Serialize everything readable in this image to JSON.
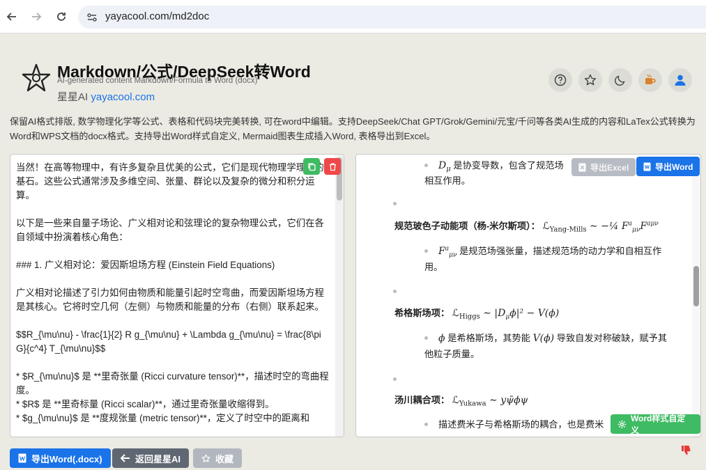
{
  "browser": {
    "url": "yayacool.com/md2doc",
    "back_icon": "arrow-left-icon",
    "forward_icon": "arrow-right-icon",
    "reload_icon": "reload-icon"
  },
  "header": {
    "title": "Markdown/公式/DeepSeek转Word",
    "subtitle": "AI-generated content Markdown/Formula to Word (docx)",
    "brand_name": "星星AI",
    "brand_link": "yayacool.com",
    "icons": [
      "help-icon",
      "star-icon",
      "moon-icon",
      "coffee-icon",
      "user-icon"
    ]
  },
  "description": "保留AI格式排版, 数学物理化学等公式、表格和代码块完美转换, 可在word中编辑。支持DeepSeek/Chat GPT/Grok/Gemini/元宝/千问等各类AI生成的内容和LaTex公式转换为Word和WPS文档的docx格式。支持导出Word样式自定义, Mermaid图表生成插入Word, 表格导出到Excel。",
  "editor": {
    "text": "当然！在高等物理中，有许多复杂且优美的公式，它们是现代物理学理论的基石。这些公式通常涉及多维空间、张量、群论以及复杂的微分和积分运算。\n\n以下是一些来自量子场论、广义相对论和弦理论的复杂物理公式，它们在各自领域中扮演着核心角色：\n\n### 1. 广义相对论：爱因斯坦场方程 (Einstein Field Equations)\n\n广义相对论描述了引力如何由物质和能量引起时空弯曲，而爱因斯坦场方程是其核心。它将时空几何（左侧）与物质和能量的分布（右侧）联系起来。\n\n$$R_{\\mu\\nu} - \\frac{1}{2} R g_{\\mu\\nu} + \\Lambda g_{\\mu\\nu} = \\frac{8\\pi G}{c^4} T_{\\mu\\nu}$$\n\n* $R_{\\mu\\nu}$ 是 **里奇张量 (Ricci curvature tensor)**，描述时空的弯曲程度。\n* $R$ 是 **里奇标量 (Ricci scalar)**，通过里奇张量收缩得到。\n* $g_{\\mu\\nu}$ 是 **度规张量 (metric tensor)**，定义了时空中的距离和",
    "copy_icon": "copy-icon",
    "delete_icon": "trash-icon"
  },
  "preview": {
    "export_excel_label": "导出Excel",
    "export_word_label": "导出Word",
    "word_style_label": "Word样式自定义",
    "items": [
      {
        "math": "D",
        "math_sub": "μ",
        "text": " 是协变导数，包含了规范场",
        "cont": "相互作用。"
      },
      {
        "heading": "规范玻色子动能项（杨-米尔斯项）：",
        "formula_main": "ℒ",
        "formula_sub": "Yang-Mills",
        "formula_tail": " ∼ −¼ F",
        "formula_tail_sup": "a",
        "formula_tail_sub": "μν",
        "formula_tail2": "F",
        "formula_tail2_sup": "aμν"
      },
      {
        "math": "F",
        "math_sup": "a",
        "math_sub": "μν",
        "text": " 是规范场强张量，描述规范场的动力学和自相互作",
        "cont": "用。"
      },
      {
        "heading": "希格斯场项：",
        "formula_main": "ℒ",
        "formula_sub": "Higgs",
        "formula_tail": " ∼ |D",
        "formula_tail_sub": "μ",
        "formula_tail2": "ϕ|² − V(ϕ)"
      },
      {
        "math": "ϕ",
        "text": " 是希格斯场，其势能 ",
        "math2": "V(ϕ)",
        "text2": " 导致自发对称破缺，赋予其",
        "cont": "他粒子质量。"
      },
      {
        "heading": "汤川耦合项：",
        "formula_main": "ℒ",
        "formula_sub": "Yukawa",
        "formula_tail": " ∼ yψ̄ϕψ"
      },
      {
        "text": "描述费米子与希格斯场的耦合，也是费米"
      }
    ]
  },
  "bottom_buttons": {
    "export_docx": "导出Word(.docx)",
    "back": "返回星星AI",
    "favorite": "收藏"
  },
  "colors": {
    "accent": "#1a73e8",
    "danger": "#f04848",
    "success": "#3fbb63",
    "page_bg": "#ebeae3"
  }
}
